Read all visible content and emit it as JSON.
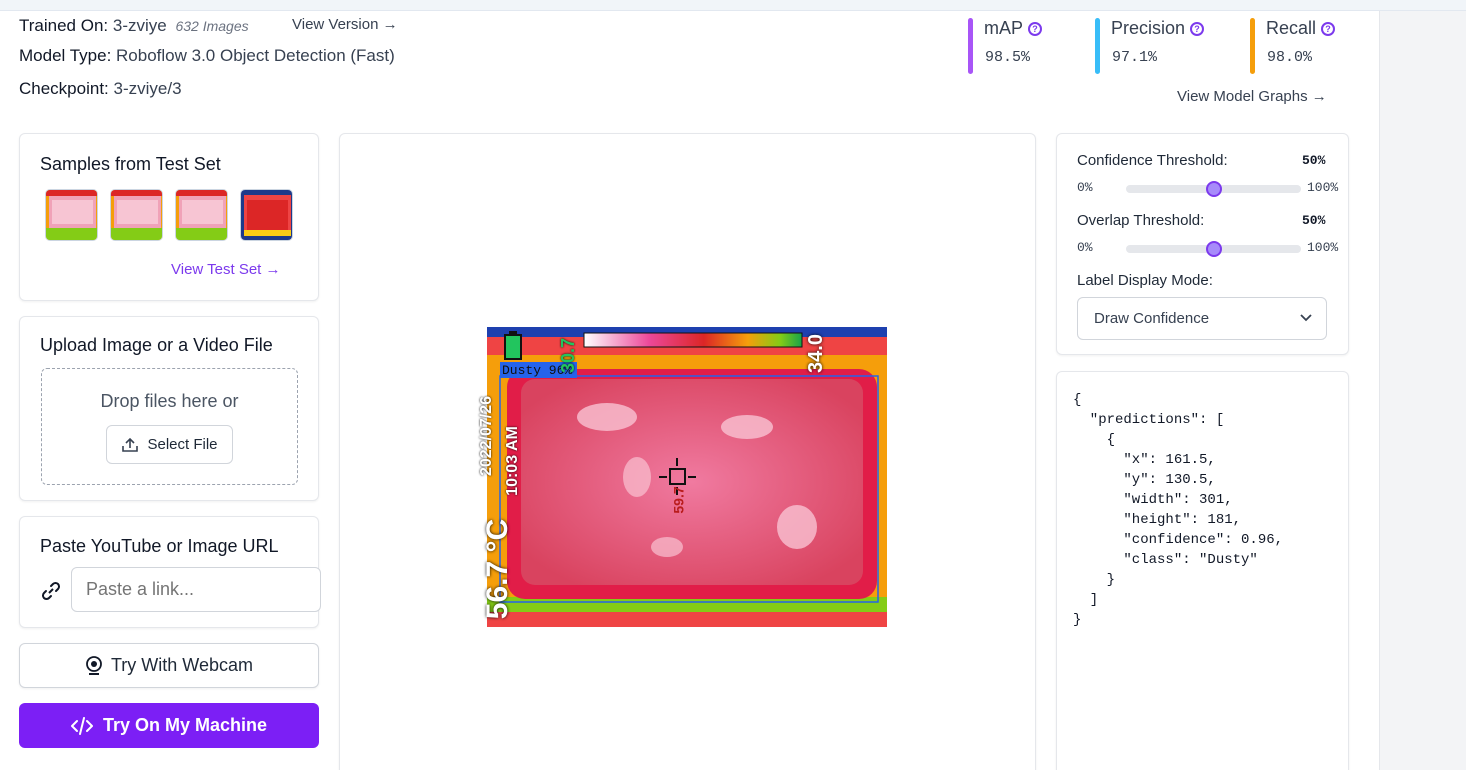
{
  "model": {
    "trained_on_label": "Trained On:",
    "trained_on_value": "3-zviye",
    "images_count": "632 Images",
    "view_version": "View Version",
    "model_type_label": "Model Type:",
    "model_type_value": "Roboflow 3.0 Object Detection (Fast)",
    "checkpoint_label": "Checkpoint:",
    "checkpoint_value": "3-zviye/3"
  },
  "metrics": [
    {
      "name": "mAP",
      "value": "98.5%",
      "color": "#a855f7"
    },
    {
      "name": "Precision",
      "value": "97.1%",
      "color": "#38bdf8"
    },
    {
      "name": "Recall",
      "value": "98.0%",
      "color": "#f59e0b"
    }
  ],
  "view_model_graphs": "View Model Graphs",
  "samples": {
    "title": "Samples from Test Set",
    "link": "View Test Set"
  },
  "upload": {
    "title": "Upload Image or a Video File",
    "drop_text": "Drop files here or",
    "select_file": "Select File"
  },
  "url_paste": {
    "title": "Paste YouTube or Image URL",
    "placeholder": "Paste a link..."
  },
  "webcam": {
    "label": "Try With Webcam"
  },
  "machine": {
    "label": "Try On My Machine"
  },
  "preview": {
    "box_label": "Dusty 96%",
    "overlay_date": "2022/07/26",
    "overlay_time": "10:03 AM",
    "overlay_temp_main": "56.7 °C",
    "overlay_temp_top": "34.0",
    "overlay_temp_left": "30.7",
    "overlay_center_value": "59.7"
  },
  "settings": {
    "confidence_label": "Confidence Threshold:",
    "confidence_value": "50%",
    "confidence_level": 0.5,
    "overlap_label": "Overlap Threshold:",
    "overlap_value": "50%",
    "overlap_level": 0.5,
    "min_label": "0%",
    "max_label": "100%",
    "label_mode_label": "Label Display Mode:",
    "label_mode_value": "Draw Confidence"
  },
  "predictions_json": "{\n  \"predictions\": [\n    {\n      \"x\": 161.5,\n      \"y\": 130.5,\n      \"width\": 301,\n      \"height\": 181,\n      \"confidence\": 0.96,\n      \"class\": \"Dusty\"\n    }\n  ]\n}"
}
